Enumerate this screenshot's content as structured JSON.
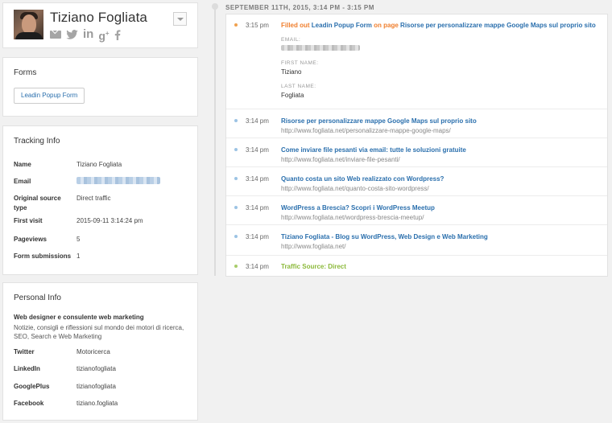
{
  "profile": {
    "name": "Tiziano Fogliata",
    "social_icons": [
      "mail-icon",
      "twitter-icon",
      "linkedin-icon",
      "googleplus-icon",
      "facebook-icon"
    ]
  },
  "forms": {
    "title": "Forms",
    "button_label": "Leadin Popup Form"
  },
  "tracking": {
    "title": "Tracking Info",
    "rows": [
      {
        "key": "Name",
        "value": "Tiziano Fogliata"
      },
      {
        "key": "Email",
        "value": ""
      },
      {
        "key": "Original source type",
        "value": "Direct traffic"
      },
      {
        "key": "First visit",
        "value": "2015-09-11 3:14:24 pm"
      },
      {
        "key": "Pageviews",
        "value": "5"
      },
      {
        "key": "Form submissions",
        "value": "1"
      }
    ]
  },
  "personal": {
    "title": "Personal Info",
    "bio_title": "Web designer e consulente web marketing",
    "bio_text": "Notizie, consigli e riflessioni sul mondo dei motori di ricerca, SEO, Search e Web Marketing",
    "rows": [
      {
        "key": "Twitter",
        "value": "Motoricerca"
      },
      {
        "key": "LinkedIn",
        "value": "tizianofogliata"
      },
      {
        "key": "GooglePlus",
        "value": "tizianofogliata"
      },
      {
        "key": "Facebook",
        "value": "tiziano.fogliata"
      }
    ]
  },
  "timeline": {
    "date": "SEPTEMBER 11TH, 2015, 3:14 PM - 3:15 PM",
    "form_event": {
      "time": "3:15 pm",
      "prefix": "Filled out",
      "form_name": "Leadin Popup Form",
      "mid": "on page",
      "page_title": "Risorse per personalizzare mappe Google Maps sul proprio sito",
      "fields": [
        {
          "label": "EMAIL:",
          "value": ""
        },
        {
          "label": "FIRST NAME:",
          "value": "Tiziano"
        },
        {
          "label": "LAST NAME:",
          "value": "Fogliata"
        }
      ]
    },
    "page_events": [
      {
        "time": "3:14 pm",
        "title": "Risorse per personalizzare mappe Google Maps sul proprio sito",
        "url": "http://www.fogliata.net/personalizzare-mappe-google-maps/"
      },
      {
        "time": "3:14 pm",
        "title": "Come inviare file pesanti via email: tutte le soluzioni gratuite",
        "url": "http://www.fogliata.net/inviare-file-pesanti/"
      },
      {
        "time": "3:14 pm",
        "title": "Quanto costa un sito Web realizzato con Wordpress?",
        "url": "http://www.fogliata.net/quanto-costa-sito-wordpress/"
      },
      {
        "time": "3:14 pm",
        "title": "WordPress a Brescia? Scopri i WordPress Meetup",
        "url": "http://www.fogliata.net/wordpress-brescia-meetup/"
      },
      {
        "time": "3:14 pm",
        "title": "Tiziano Fogliata - Blog su WordPress, Web Design e Web Marketing",
        "url": "http://www.fogliata.net/"
      }
    ],
    "source_event": {
      "time": "3:14 pm",
      "label": "Traffic Source: Direct"
    },
    "colors": {
      "form_bullet": "#f0a14f",
      "page_bullet": "#9cc3e4",
      "source_bullet": "#a8cc6a",
      "link": "#2a6fad",
      "orange": "#f07e2c",
      "green": "#8bb93a"
    }
  }
}
